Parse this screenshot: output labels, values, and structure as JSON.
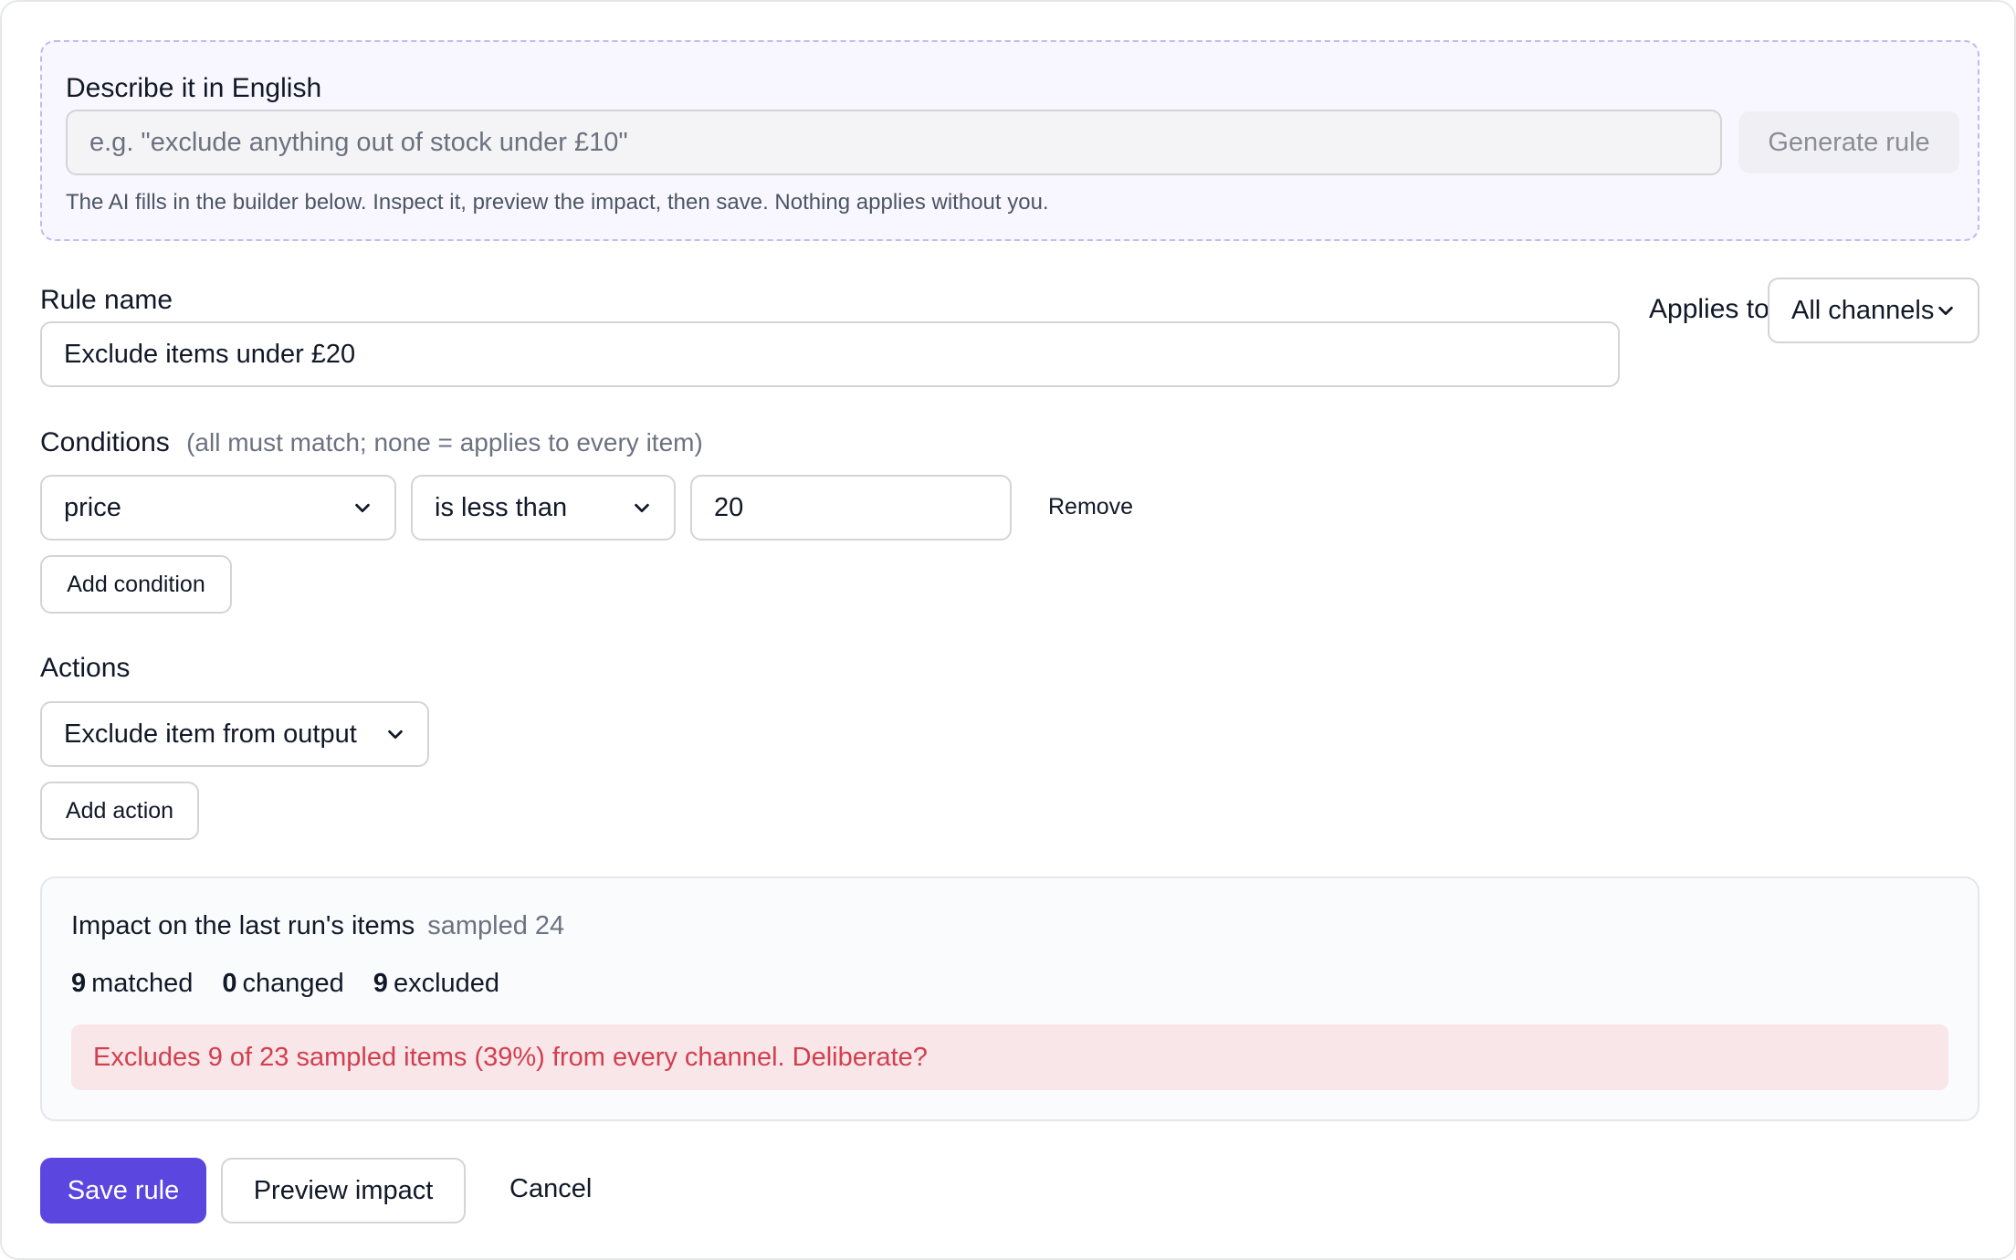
{
  "ai": {
    "label": "Describe it in English",
    "placeholder": "e.g. \"exclude anything out of stock under £10\"",
    "generate_label": "Generate rule",
    "help": "The AI fills in the builder below. Inspect it, preview the impact, then save. Nothing applies without you."
  },
  "rule": {
    "name_label": "Rule name",
    "name_value": "Exclude items under £20",
    "applies_to_label": "Applies to",
    "applies_to_value": "All channels"
  },
  "conditions": {
    "label": "Conditions",
    "hint": "(all must match; none = applies to every item)",
    "items": [
      {
        "field": "price",
        "operator": "is less than",
        "value": "20",
        "remove_label": "Remove"
      }
    ],
    "add_label": "Add condition"
  },
  "actions": {
    "label": "Actions",
    "items": [
      {
        "action": "Exclude item from output"
      }
    ],
    "add_label": "Add action"
  },
  "impact": {
    "title": "Impact on the last run's items",
    "sampled": "sampled 24",
    "stats": [
      {
        "count": "9",
        "label": "matched"
      },
      {
        "count": "0",
        "label": "changed"
      },
      {
        "count": "9",
        "label": "excluded"
      }
    ],
    "warning": "Excludes 9 of 23 sampled items (39%) from every channel. Deliberate?"
  },
  "footer": {
    "save_label": "Save rule",
    "preview_label": "Preview impact",
    "cancel_label": "Cancel"
  },
  "colors": {
    "accent": "#5b47e0",
    "warning_text": "#d23f4f",
    "warning_bg": "#f8e6e9",
    "ai_border": "#c4b8f5"
  },
  "icons": {
    "select_caret": "chevron-down-icon"
  }
}
